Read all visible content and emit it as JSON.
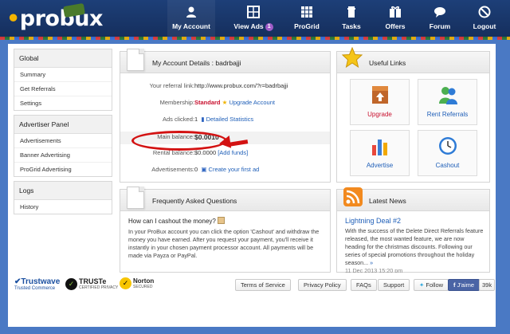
{
  "header": {
    "logo": "probux",
    "nav": [
      {
        "label": "My Account",
        "icon": "user-icon"
      },
      {
        "label": "View Ads",
        "icon": "grid-icon",
        "badge": "1"
      },
      {
        "label": "ProGrid",
        "icon": "progrid-icon"
      },
      {
        "label": "Tasks",
        "icon": "tasks-icon"
      },
      {
        "label": "Offers",
        "icon": "offers-icon"
      },
      {
        "label": "Forum",
        "icon": "forum-icon"
      },
      {
        "label": "Logout",
        "icon": "logout-icon"
      }
    ]
  },
  "sidebar": {
    "global": {
      "title": "Global",
      "items": [
        "Summary",
        "Get Referrals",
        "Settings"
      ]
    },
    "advertiser": {
      "title": "Advertiser Panel",
      "items": [
        "Advertisements",
        "Banner Advertising",
        "ProGrid Advertising"
      ]
    },
    "logs": {
      "title": "Logs",
      "items": [
        "History"
      ]
    }
  },
  "account": {
    "title": "My Account Details : badrbajji",
    "referral_label": "Your referral link:",
    "referral_value": "http://www.probux.com/?r=badrbajji",
    "membership_label": "Membership:",
    "membership_value": "Standard",
    "upgrade_link": "Upgrade Account",
    "ads_label": "Ads clicked:",
    "ads_value": "1",
    "stats_link": "Detailed Statistics",
    "main_balance_label": "Main balance:",
    "main_balance_value": "$0.0010",
    "rental_label": "Rental balance:",
    "rental_value": "$0.0000",
    "add_funds_link": "[Add funds]",
    "advertisements_label": "Advertisements:",
    "advertisements_value": "0",
    "create_ad_link": "Create your first ad"
  },
  "useful_links": {
    "title": "Useful Links",
    "tiles": [
      "Upgrade",
      "Rent Referrals",
      "Advertise",
      "Cashout"
    ]
  },
  "faq": {
    "title": "Frequently Asked Questions",
    "question": "How can I cashout the money?",
    "answer": "In your ProBux account you can click the option 'Cashout' and withdraw the money you have earned. After you request your payment, you'll receive it instantly in your chosen payment processor account. All payments will be made via Payza or PayPal."
  },
  "news": {
    "title": "Latest News",
    "headline": "Lightning Deal #2",
    "text": "With the success of the Delete Direct Referrals feature released, the most wanted feature, we are now heading for the christmas discounts. Following our series of special promotions throughout the holiday season...",
    "more": "»",
    "date": "11 Dec 2013 15:20 pm"
  },
  "footer": {
    "trustwave": "Trustwave",
    "trustwave_sub": "Trusted Commerce",
    "truste": "TRUSTe",
    "truste_sub": "CERTIFIED PRIVACY",
    "norton": "Norton",
    "norton_sub": "SECURED",
    "links": [
      "Terms of Service",
      "Privacy Policy",
      "FAQs",
      "Support"
    ],
    "follow": "Follow",
    "like": "J'aime",
    "like_count": "39k"
  }
}
